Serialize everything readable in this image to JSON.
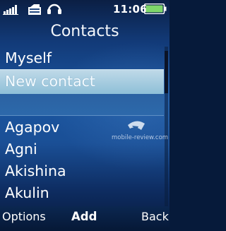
{
  "status_bar": {
    "time": "11:06",
    "icons": [
      "signal-icon",
      "message-icon",
      "headset-icon",
      "battery-icon"
    ],
    "battery_color": "#7ed66a"
  },
  "title": "Contacts",
  "list": {
    "special_items": [
      {
        "label": "Myself"
      },
      {
        "label": "New contact",
        "selected": true
      }
    ],
    "contacts": [
      {
        "label": "Agapov"
      },
      {
        "label": "Agni"
      },
      {
        "label": "Akishina"
      },
      {
        "label": "Akulin"
      }
    ]
  },
  "softkeys": {
    "left": "Options",
    "center": "Add",
    "right": "Back"
  },
  "watermark": "mobile-review.com",
  "colors": {
    "highlight": "#a9cfe2",
    "background": "#1b56a0"
  }
}
